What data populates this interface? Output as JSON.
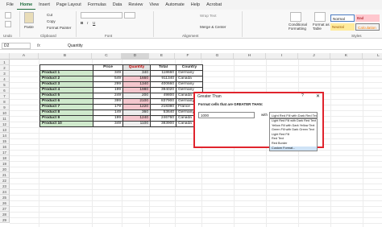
{
  "tabs": [
    "File",
    "Home",
    "Insert",
    "Page Layout",
    "Formulas",
    "Data",
    "Review",
    "View",
    "Automate",
    "Help",
    "Acrobat"
  ],
  "ribbon": {
    "cut": "Cut",
    "copy": "Copy",
    "paste": "Paste",
    "format_painter": "Format Painter",
    "undo_group": "Undo",
    "clipboard_group": "Clipboard",
    "font_group": "Font",
    "alignment_group": "Alignment",
    "wrap_text": "Wrap Text",
    "merge_center": "Merge & Center",
    "conditional_formatting": "Conditional Formatting",
    "format_as_table": "Format as Table",
    "styles_group": "Styles",
    "style_normal": "Normal",
    "style_bad": "Bad",
    "style_neutral": "Neutral",
    "style_calc": "Calculation"
  },
  "formula_bar": {
    "name_box": "D2",
    "fx": "fx",
    "value": "Quantity"
  },
  "columns": [
    "A",
    "B",
    "C",
    "D",
    "E",
    "F",
    "G",
    "H",
    "I",
    "J",
    "K",
    "L",
    "M",
    "N"
  ],
  "rows": [
    "1",
    "2",
    "3",
    "4",
    "5",
    "6",
    "7",
    "8",
    "9",
    "10",
    "11",
    "12",
    "13",
    "14",
    "15",
    "16",
    "17",
    "18",
    "19",
    "20",
    "21",
    "22",
    "23",
    "24",
    "25",
    "26",
    "27",
    "28",
    "29"
  ],
  "table": {
    "headers": [
      "",
      "Price",
      "Quantity",
      "Total",
      "Country"
    ],
    "rows": [
      [
        "Product 1",
        "349",
        "340",
        "118660",
        "Germany"
      ],
      [
        "Product 2",
        "549",
        "1660",
        "911340",
        "Canada"
      ],
      [
        "Product 3",
        "299",
        "1340",
        "400660",
        "Germany"
      ],
      [
        "Product 4",
        "199",
        "1980",
        "394020",
        "Germany"
      ],
      [
        "Product 5",
        "249",
        "200",
        "49800",
        "Canada"
      ],
      [
        "Product 6",
        "399",
        "2100",
        "837900",
        "Germany"
      ],
      [
        "Product 7",
        "179",
        "1220",
        "218380",
        "France"
      ],
      [
        "Product 8",
        "149",
        "360",
        "53640",
        "Germany"
      ],
      [
        "Product 9",
        "199",
        "1240",
        "246760",
        "Canada"
      ],
      [
        "Product 10",
        "349",
        "1100",
        "383900",
        "Canada"
      ]
    ],
    "highlighted_quantity": [
      false,
      true,
      true,
      true,
      false,
      true,
      true,
      false,
      true,
      false
    ]
  },
  "dialog": {
    "title": "Greater Than",
    "help": "?",
    "close": "✕",
    "label": "Format cells that are GREATER THAN:",
    "value": "1000",
    "with": "with",
    "selected": "Light Red Fill with Dark Red Text",
    "options": [
      "Light Red Fill with Dark Red Text",
      "Yellow Fill with Dark Yellow Text",
      "Green Fill with Dark Green Text",
      "Light Red Fill",
      "Red Text",
      "Red Border",
      "Custom Format..."
    ]
  },
  "colors": {
    "accent": "#1e6c3c",
    "product_fill": "#cfe9cc",
    "highlight_fill": "#f4c7ce",
    "dialog_border": "#e0242d"
  }
}
